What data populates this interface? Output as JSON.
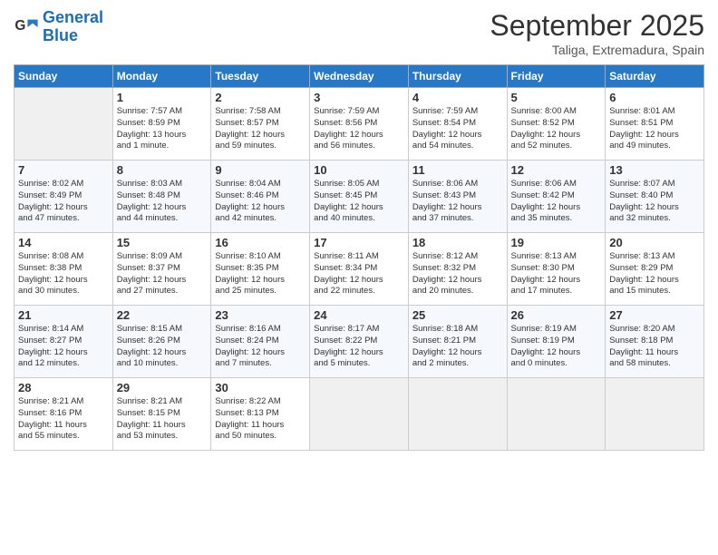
{
  "logo": {
    "line1": "General",
    "line2": "Blue"
  },
  "title": "September 2025",
  "subtitle": "Taliga, Extremadura, Spain",
  "days_of_week": [
    "Sunday",
    "Monday",
    "Tuesday",
    "Wednesday",
    "Thursday",
    "Friday",
    "Saturday"
  ],
  "weeks": [
    [
      {
        "day": "",
        "info": ""
      },
      {
        "day": "1",
        "info": "Sunrise: 7:57 AM\nSunset: 8:59 PM\nDaylight: 13 hours\nand 1 minute."
      },
      {
        "day": "2",
        "info": "Sunrise: 7:58 AM\nSunset: 8:57 PM\nDaylight: 12 hours\nand 59 minutes."
      },
      {
        "day": "3",
        "info": "Sunrise: 7:59 AM\nSunset: 8:56 PM\nDaylight: 12 hours\nand 56 minutes."
      },
      {
        "day": "4",
        "info": "Sunrise: 7:59 AM\nSunset: 8:54 PM\nDaylight: 12 hours\nand 54 minutes."
      },
      {
        "day": "5",
        "info": "Sunrise: 8:00 AM\nSunset: 8:52 PM\nDaylight: 12 hours\nand 52 minutes."
      },
      {
        "day": "6",
        "info": "Sunrise: 8:01 AM\nSunset: 8:51 PM\nDaylight: 12 hours\nand 49 minutes."
      }
    ],
    [
      {
        "day": "7",
        "info": "Sunrise: 8:02 AM\nSunset: 8:49 PM\nDaylight: 12 hours\nand 47 minutes."
      },
      {
        "day": "8",
        "info": "Sunrise: 8:03 AM\nSunset: 8:48 PM\nDaylight: 12 hours\nand 44 minutes."
      },
      {
        "day": "9",
        "info": "Sunrise: 8:04 AM\nSunset: 8:46 PM\nDaylight: 12 hours\nand 42 minutes."
      },
      {
        "day": "10",
        "info": "Sunrise: 8:05 AM\nSunset: 8:45 PM\nDaylight: 12 hours\nand 40 minutes."
      },
      {
        "day": "11",
        "info": "Sunrise: 8:06 AM\nSunset: 8:43 PM\nDaylight: 12 hours\nand 37 minutes."
      },
      {
        "day": "12",
        "info": "Sunrise: 8:06 AM\nSunset: 8:42 PM\nDaylight: 12 hours\nand 35 minutes."
      },
      {
        "day": "13",
        "info": "Sunrise: 8:07 AM\nSunset: 8:40 PM\nDaylight: 12 hours\nand 32 minutes."
      }
    ],
    [
      {
        "day": "14",
        "info": "Sunrise: 8:08 AM\nSunset: 8:38 PM\nDaylight: 12 hours\nand 30 minutes."
      },
      {
        "day": "15",
        "info": "Sunrise: 8:09 AM\nSunset: 8:37 PM\nDaylight: 12 hours\nand 27 minutes."
      },
      {
        "day": "16",
        "info": "Sunrise: 8:10 AM\nSunset: 8:35 PM\nDaylight: 12 hours\nand 25 minutes."
      },
      {
        "day": "17",
        "info": "Sunrise: 8:11 AM\nSunset: 8:34 PM\nDaylight: 12 hours\nand 22 minutes."
      },
      {
        "day": "18",
        "info": "Sunrise: 8:12 AM\nSunset: 8:32 PM\nDaylight: 12 hours\nand 20 minutes."
      },
      {
        "day": "19",
        "info": "Sunrise: 8:13 AM\nSunset: 8:30 PM\nDaylight: 12 hours\nand 17 minutes."
      },
      {
        "day": "20",
        "info": "Sunrise: 8:13 AM\nSunset: 8:29 PM\nDaylight: 12 hours\nand 15 minutes."
      }
    ],
    [
      {
        "day": "21",
        "info": "Sunrise: 8:14 AM\nSunset: 8:27 PM\nDaylight: 12 hours\nand 12 minutes."
      },
      {
        "day": "22",
        "info": "Sunrise: 8:15 AM\nSunset: 8:26 PM\nDaylight: 12 hours\nand 10 minutes."
      },
      {
        "day": "23",
        "info": "Sunrise: 8:16 AM\nSunset: 8:24 PM\nDaylight: 12 hours\nand 7 minutes."
      },
      {
        "day": "24",
        "info": "Sunrise: 8:17 AM\nSunset: 8:22 PM\nDaylight: 12 hours\nand 5 minutes."
      },
      {
        "day": "25",
        "info": "Sunrise: 8:18 AM\nSunset: 8:21 PM\nDaylight: 12 hours\nand 2 minutes."
      },
      {
        "day": "26",
        "info": "Sunrise: 8:19 AM\nSunset: 8:19 PM\nDaylight: 12 hours\nand 0 minutes."
      },
      {
        "day": "27",
        "info": "Sunrise: 8:20 AM\nSunset: 8:18 PM\nDaylight: 11 hours\nand 58 minutes."
      }
    ],
    [
      {
        "day": "28",
        "info": "Sunrise: 8:21 AM\nSunset: 8:16 PM\nDaylight: 11 hours\nand 55 minutes."
      },
      {
        "day": "29",
        "info": "Sunrise: 8:21 AM\nSunset: 8:15 PM\nDaylight: 11 hours\nand 53 minutes."
      },
      {
        "day": "30",
        "info": "Sunrise: 8:22 AM\nSunset: 8:13 PM\nDaylight: 11 hours\nand 50 minutes."
      },
      {
        "day": "",
        "info": ""
      },
      {
        "day": "",
        "info": ""
      },
      {
        "day": "",
        "info": ""
      },
      {
        "day": "",
        "info": ""
      }
    ]
  ]
}
